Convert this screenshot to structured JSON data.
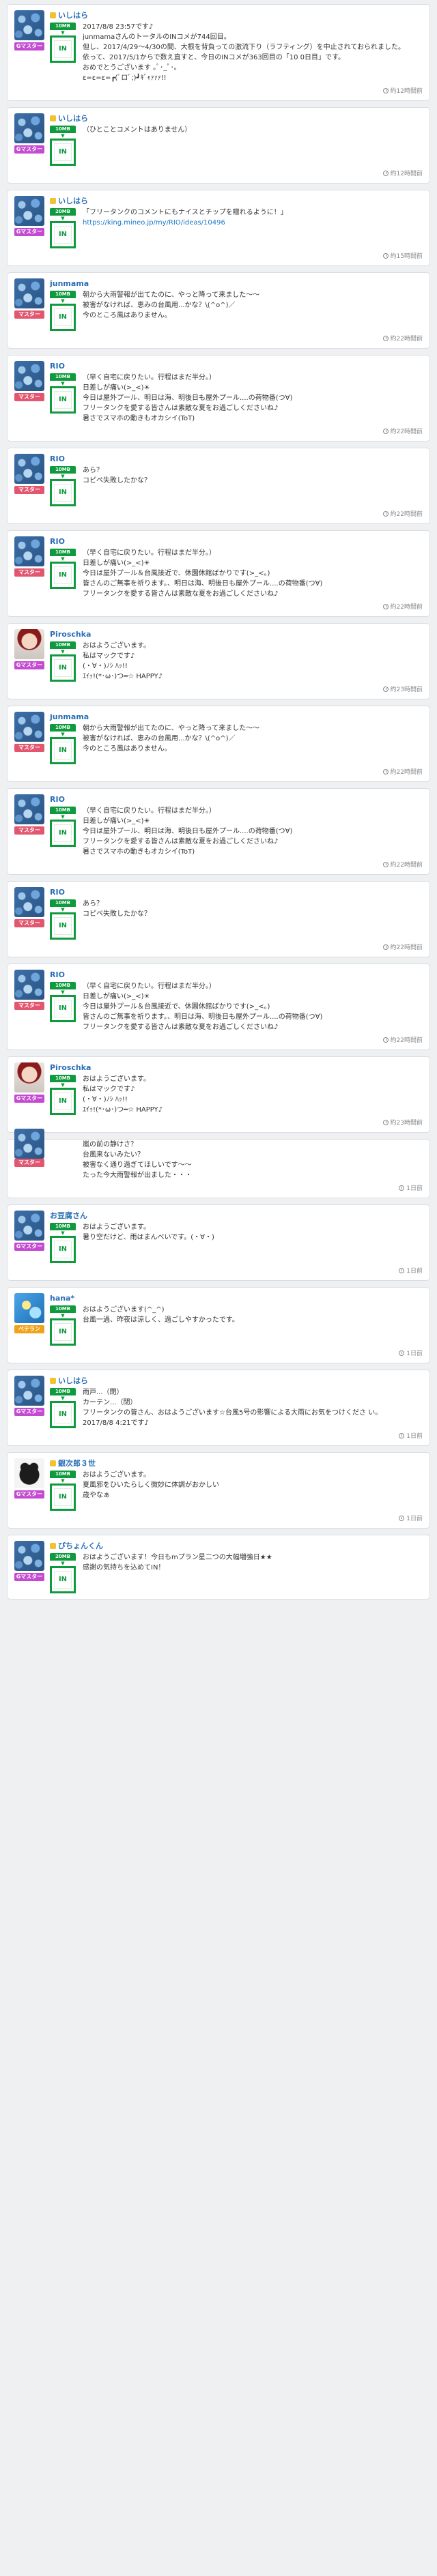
{
  "posts": [
    {
      "user": "いしはら",
      "mark": true,
      "badge": "Gマスター",
      "badge_color": "g",
      "avatar": "hyd",
      "chip": "10MB",
      "in": "IN",
      "text": "2017/8/8 23:57です♪\njunmamaさんのトータルのINコメが744回目。\n但し、2017/4/29〜4/30の間、大根を背負っての激流下り（ラフティング）を中止されておられました。\n依って、2017/5/1からで数え直すと、今日のINコメが363回目の「10 0日目」です。\nおめでとうございます ｡ﾟ･_ﾟ･｡\nε=ε=ε=┏(ﾟロﾟ;)┛ｷﾞｬｧｧｧ!!",
      "link": "",
      "time": "約12時間前"
    },
    {
      "user": "いしはら",
      "mark": true,
      "badge": "Gマスター",
      "badge_color": "g",
      "avatar": "hyd",
      "chip": "10MB",
      "in": "IN",
      "text": "（ひとことコメントはありません）",
      "link": "",
      "time": "約12時間前"
    },
    {
      "user": "いしはら",
      "mark": true,
      "badge": "Gマスター",
      "badge_color": "g",
      "avatar": "hyd",
      "chip": "20MB",
      "in": "IN",
      "text": "「フリータンクのコメントにもナイスとチップを贈れるように！」",
      "link": "https://king.mineo.jp/my/RIO/ideas/10496",
      "time": "約15時間前"
    },
    {
      "user": "junmama",
      "mark": false,
      "badge": "マスター",
      "badge_color": "m",
      "avatar": "hyd",
      "chip": "10MB",
      "in": "IN",
      "text": "朝から大雨警報が出てたのに、やっと降って来ました〜〜\n被害がなければ、恵みの台風用...かな？\\(^o^)／\n今のところ風はありません。",
      "link": "",
      "time": "約22時間前"
    },
    {
      "user": "RIO",
      "mark": false,
      "badge": "マスター",
      "badge_color": "m",
      "avatar": "hyd",
      "chip": "10MB",
      "in": "IN",
      "text": "（早く自宅に戻りたい。行程はまだ半分。）\n日差しが痛い(>_<)☀\n今日は屋外プール、明日は海、明後日も屋外プール....の荷物番(つ∀)\nフリータンクを愛する皆さんは素敵な夏をお過ごしくださいね♪\n暑さでスマホの動きもオカシイ(ToT)",
      "link": "",
      "time": "約22時間前"
    },
    {
      "user": "RIO",
      "mark": false,
      "badge": "マスター",
      "badge_color": "m",
      "avatar": "hyd",
      "chip": "10MB",
      "in": "IN",
      "text": "あら？\nコピペ失敗したかな？",
      "link": "",
      "time": "約22時間前"
    },
    {
      "user": "RIO",
      "mark": false,
      "badge": "マスター",
      "badge_color": "m",
      "avatar": "hyd",
      "chip": "10MB",
      "in": "IN",
      "text": "（早く自宅に戻りたい。行程はまだ半分。）\n日差しが痛い(>_<)☀\n今日は屋外プール＆台風接近で、休園休館ばかりです(>_<。)\n皆さんのご無事を祈ります。、明日は海、明後日も屋外プール....の荷物番(つ∀)\nフリータンクを愛する皆さんは素敵な夏をお過ごしくださいね♪",
      "link": "",
      "time": "約22時間前"
    },
    {
      "user": "Piroschka",
      "mark": false,
      "badge": "Gマスター",
      "badge_color": "g",
      "avatar": "girl",
      "chip": "10MB",
      "in": "IN",
      "text": "おはようございます。\n私はマックです♪\n(・∀・)ﾉｼ ﾊｯ!!\nｴｲｯ!(*･ω･)つ━☆ HAPPY♪",
      "link": "",
      "time": "約23時間前"
    },
    {
      "user": "junmama",
      "mark": false,
      "badge": "マスター",
      "badge_color": "m",
      "avatar": "hyd",
      "chip": "10MB",
      "in": "IN",
      "text": "朝から大雨警報が出てたのに、やっと降って来ました〜〜\n被害がなければ、恵みの台風用...かな？\\(^o^)／\n今のところ風はありません。",
      "link": "",
      "time": "約22時間前"
    },
    {
      "user": "RIO",
      "mark": false,
      "badge": "マスター",
      "badge_color": "m",
      "avatar": "hyd",
      "chip": "10MB",
      "in": "IN",
      "text": "（早く自宅に戻りたい。行程はまだ半分。）\n日差しが痛い(>_<)☀\n今日は屋外プール、明日は海、明後日も屋外プール....の荷物番(つ∀)\nフリータンクを愛する皆さんは素敵な夏をお過ごしくださいね♪\n暑さでスマホの動きもオカシイ(ToT)",
      "link": "",
      "time": "約22時間前"
    },
    {
      "user": "RIO",
      "mark": false,
      "badge": "マスター",
      "badge_color": "m",
      "avatar": "hyd",
      "chip": "10MB",
      "in": "IN",
      "text": "あら？\nコピペ失敗したかな？",
      "link": "",
      "time": "約22時間前"
    },
    {
      "user": "RIO",
      "mark": false,
      "badge": "マスター",
      "badge_color": "m",
      "avatar": "hyd",
      "chip": "10MB",
      "in": "IN",
      "text": "（早く自宅に戻りたい。行程はまだ半分。）\n日差しが痛い(>_<)☀\n今日は屋外プール＆台風接近で、休園休館ばかりです(>_<。)\n皆さんのご無事を祈ります。、明日は海、明後日も屋外プール....の荷物番(つ∀)\nフリータンクを愛する皆さんは素敵な夏をお過ごしくださいね♪",
      "link": "",
      "time": "約22時間前"
    },
    {
      "user": "Piroschka",
      "mark": false,
      "badge": "Gマスター",
      "badge_color": "g",
      "avatar": "girl",
      "chip": "10MB",
      "in": "IN",
      "text": "おはようございます。\n私はマックです♪\n(・∀・)ﾉｼ ﾊｯ!!\nｴｲｯ!(*･ω･)つ━☆ HAPPY♪",
      "link": "",
      "time": "約23時間前"
    }
  ],
  "partial_post": {
    "badge": "マスター",
    "badge_color": "m",
    "avatar": "hyd",
    "text": "嵐の前の静けさ？\n台風来ないみたい？\n被害なく通り過ぎてほしいです〜〜\nたった今大雨警報が出ました・・・",
    "time": "1日前"
  },
  "posts_bottom": [
    {
      "user": "お豆腐さん",
      "mark": false,
      "badge": "Gマスター",
      "badge_color": "g",
      "avatar": "hyd",
      "chip": "10MB",
      "in": "IN",
      "text": "おはようございます。\n暑り空だけど、雨はまんべいです。(・∀・)",
      "link": "",
      "time": "1日前"
    },
    {
      "user": "hana*",
      "mark": false,
      "badge": "ベテラン",
      "badge_color": "b",
      "avatar": "blue",
      "chip": "10MB",
      "in": "IN",
      "text": "おはようございます(^_^)\n台風一過、昨夜は涼しく、過ごしやすかったです。",
      "link": "",
      "time": "1日前"
    },
    {
      "user": "いしはら",
      "mark": true,
      "badge": "Gマスター",
      "badge_color": "g",
      "avatar": "hyd",
      "chip": "10MB",
      "in": "IN",
      "text": "雨戸...（閉）\nカーテン...（閉）\nフリータンクの皆さん、おはようございます☆台風5号の影響による大雨にお気をつけくださ い。\n2017/8/8 4:21です♪",
      "link": "",
      "time": "1日前"
    },
    {
      "user": "銀次郎３世",
      "mark": true,
      "badge": "Gマスター",
      "badge_color": "g",
      "avatar": "cat",
      "chip": "10MB",
      "in": "IN",
      "text": "おはようございます。\n夏風邪をひいたらしく微妙に体調がおかしい\n歳やなぁ",
      "link": "",
      "time": "1日前"
    },
    {
      "user": "ぴちょんくん",
      "mark": true,
      "badge": "Gマスター",
      "badge_color": "g",
      "avatar": "hyd",
      "chip": "20MB",
      "in": "IN",
      "text": "おはようございます！今日もmプラン星二つの大幅増強日★★\n感謝の気持ちを込めてIN！",
      "link": "",
      "time": ""
    }
  ]
}
